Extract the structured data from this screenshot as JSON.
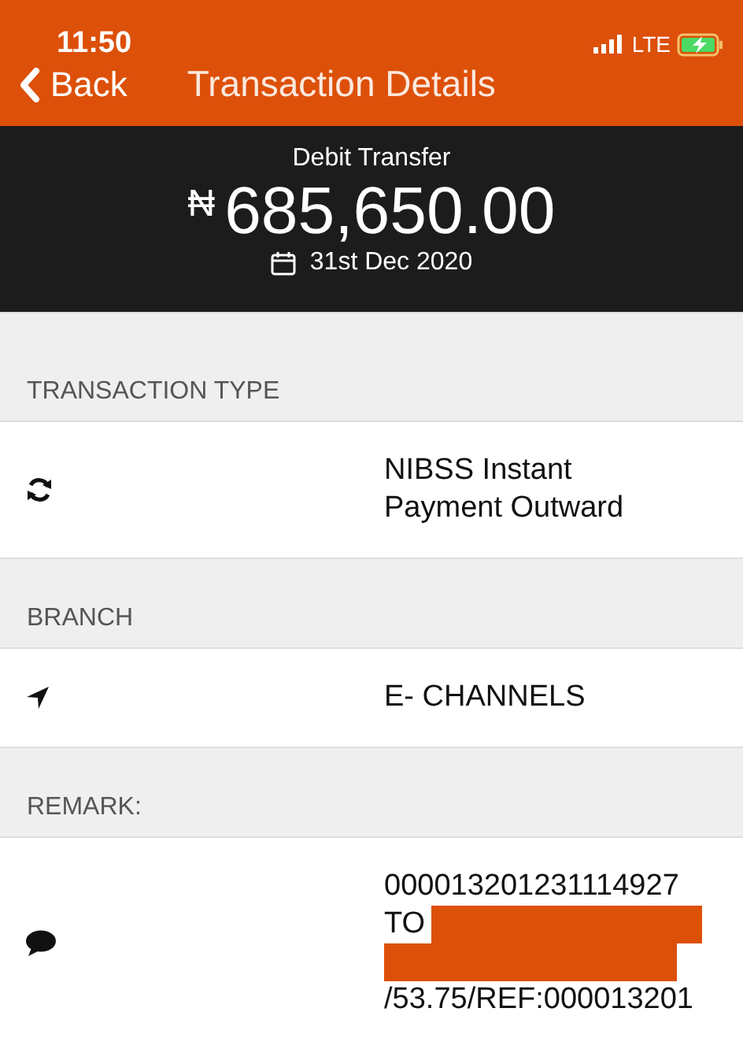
{
  "status_bar": {
    "time": "11:50",
    "network": "LTE"
  },
  "nav": {
    "back": "Back",
    "title": "Transaction Details"
  },
  "summary": {
    "type": "Debit Transfer",
    "currency": "₦",
    "amount": "685,650.00",
    "date": "31st Dec 2020"
  },
  "sections": [
    {
      "header": "TRANSACTION TYPE",
      "lines": [
        {
          "text": "NIBSS Instant"
        },
        {
          "text": "Payment Outward"
        }
      ]
    },
    {
      "header": "BRANCH",
      "lines": [
        {
          "text": "E- CHANNELS"
        }
      ]
    },
    {
      "header": "REMARK:",
      "lines": [
        {
          "text": "000013201231114927"
        },
        {
          "text": "TO",
          "redacted": true
        },
        {
          "redacted": true
        },
        {
          "text": "/53.75/REF:000013201"
        }
      ]
    }
  ]
}
